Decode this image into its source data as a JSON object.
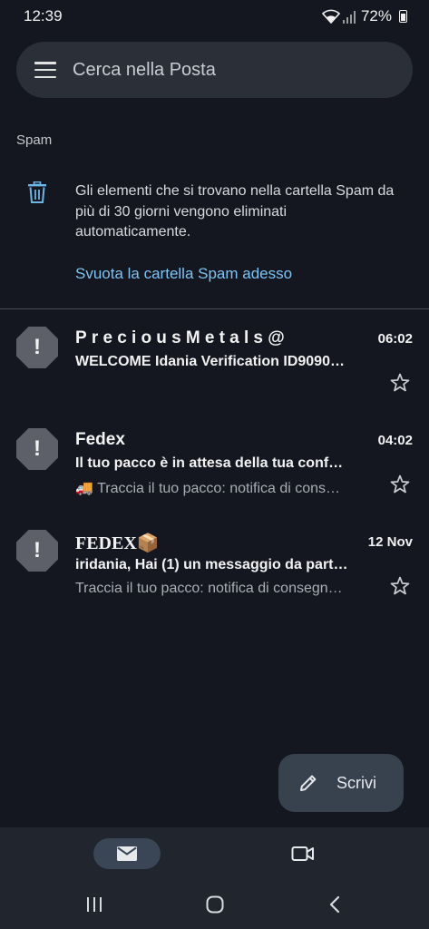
{
  "status_bar": {
    "time": "12:39",
    "battery": "72%"
  },
  "search": {
    "placeholder": "Cerca nella Posta"
  },
  "folder": {
    "label": "Spam"
  },
  "info": {
    "text": "Gli elementi che si trovano nella cartella Spam da più di 30 giorni vengono eliminati automaticamente.",
    "link": "Svuota la cartella Spam adesso"
  },
  "mails": [
    {
      "sender": "PreciousMetals@",
      "time": "06:02",
      "subject": "WELCOME Idania Verification ID9090…",
      "snippet": "",
      "icon": "warning-icon"
    },
    {
      "sender": "Fedex",
      "time": "04:02",
      "subject": "Il tuo pacco è in attesa della tua conf…",
      "snippet": "🚚 Traccia il tuo pacco: notifica di cons…",
      "icon": "warning-icon"
    },
    {
      "sender": "FEDEX📦",
      "time": "12 Nov",
      "subject": "iridania, Hai (1) un messaggio da part…",
      "snippet": "Traccia il tuo pacco: notifica di consegn…",
      "icon": "warning-icon"
    }
  ],
  "compose": {
    "label": "Scrivi"
  },
  "colors": {
    "background": "#14171f",
    "link": "#7cc4f4",
    "avatar": "#5d6068",
    "compose": "#38424f"
  }
}
